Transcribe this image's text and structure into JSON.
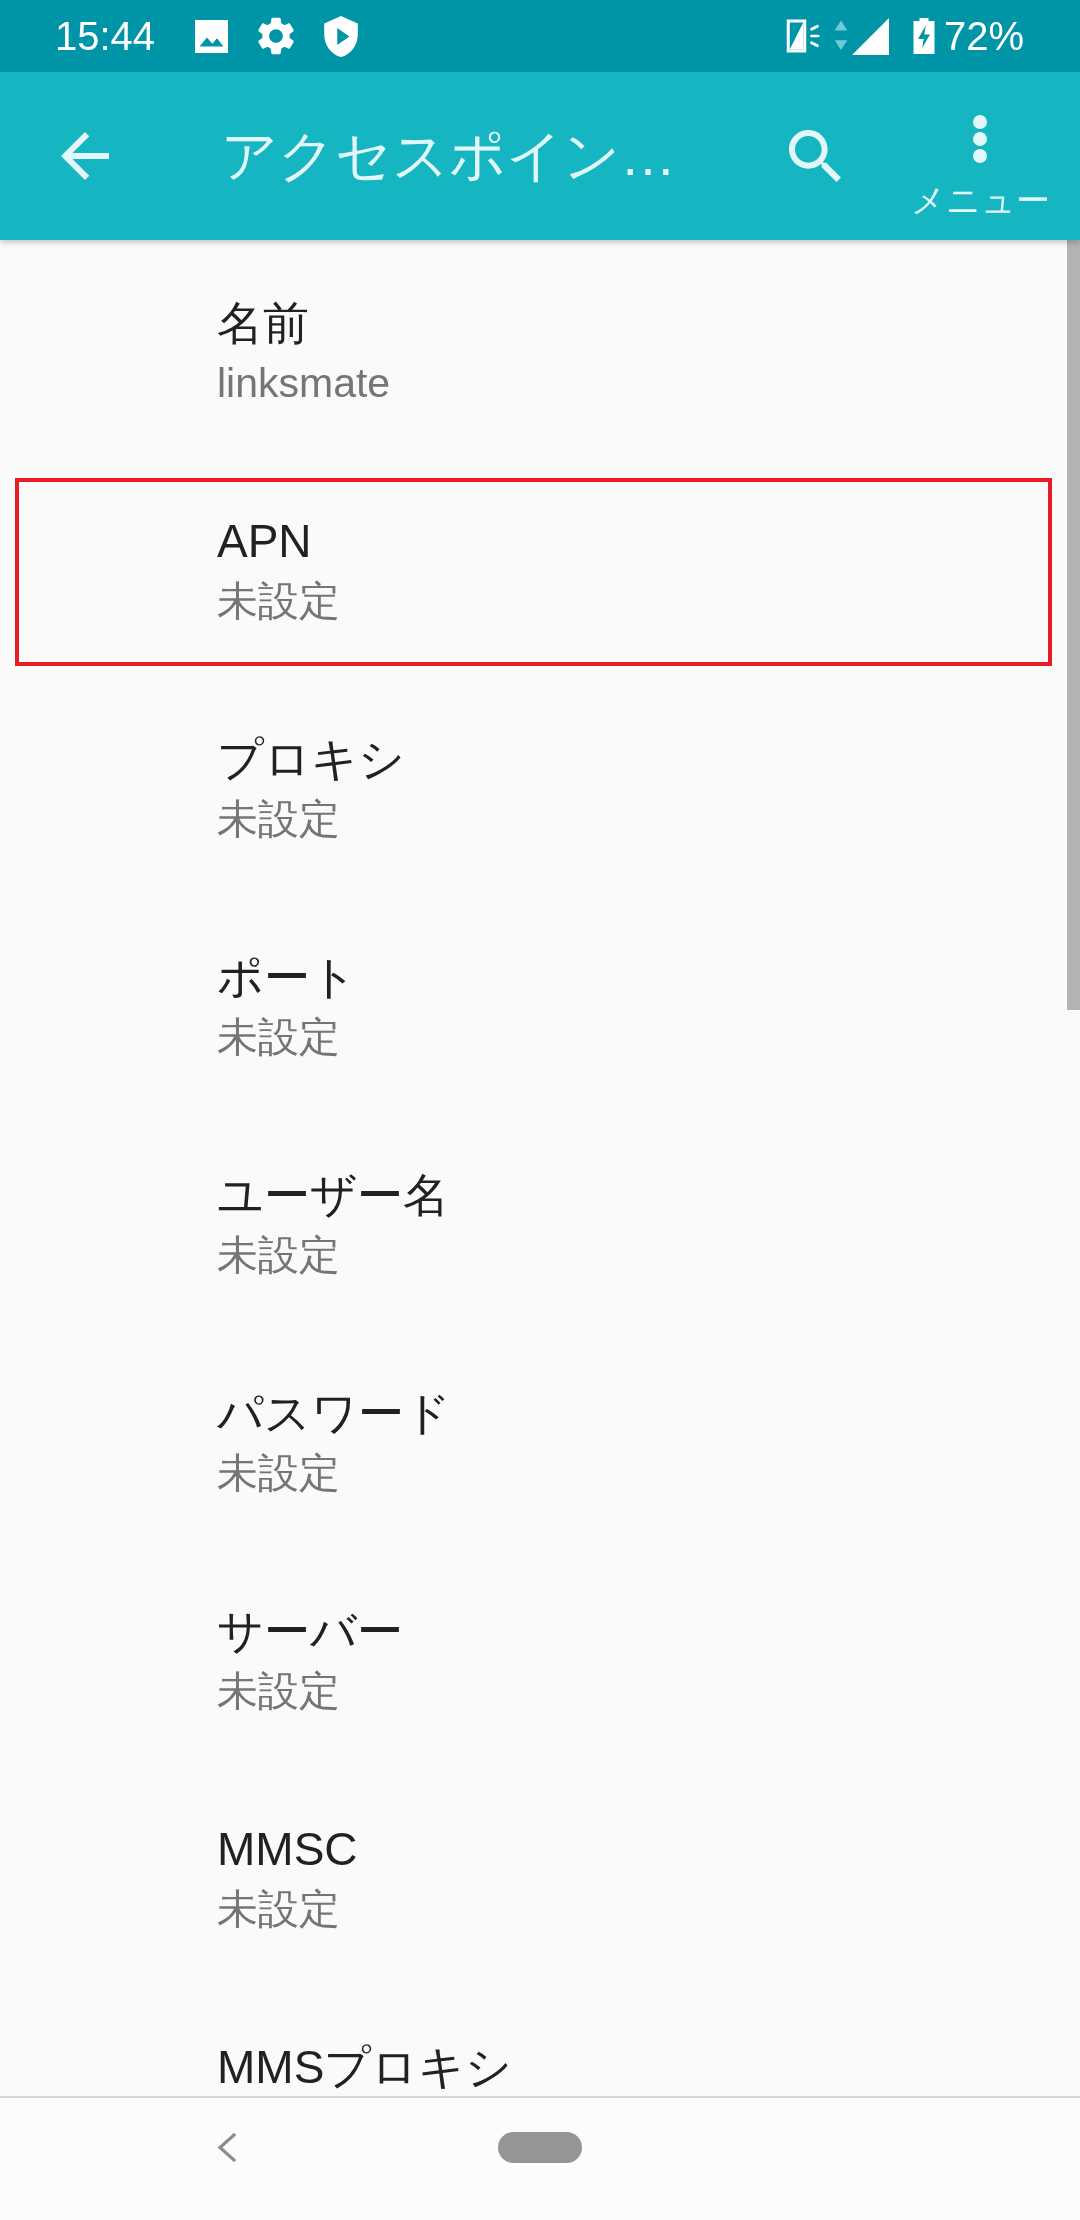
{
  "status_bar": {
    "time": "15:44",
    "battery": "72%"
  },
  "app_bar": {
    "title": "アクセスポイン…",
    "menu_label": "メニュー"
  },
  "settings": [
    {
      "title": "名前",
      "value": "linksmate",
      "highlighted": false
    },
    {
      "title": "APN",
      "value": "未設定",
      "highlighted": true
    },
    {
      "title": "プロキシ",
      "value": "未設定",
      "highlighted": false
    },
    {
      "title": "ポート",
      "value": "未設定",
      "highlighted": false
    },
    {
      "title": "ユーザー名",
      "value": "未設定",
      "highlighted": false
    },
    {
      "title": "パスワード",
      "value": "未設定",
      "highlighted": false
    },
    {
      "title": "サーバー",
      "value": "未設定",
      "highlighted": false
    },
    {
      "title": "MMSC",
      "value": "未設定",
      "highlighted": false
    },
    {
      "title": "MMSプロキシ",
      "highlighted": false
    }
  ]
}
